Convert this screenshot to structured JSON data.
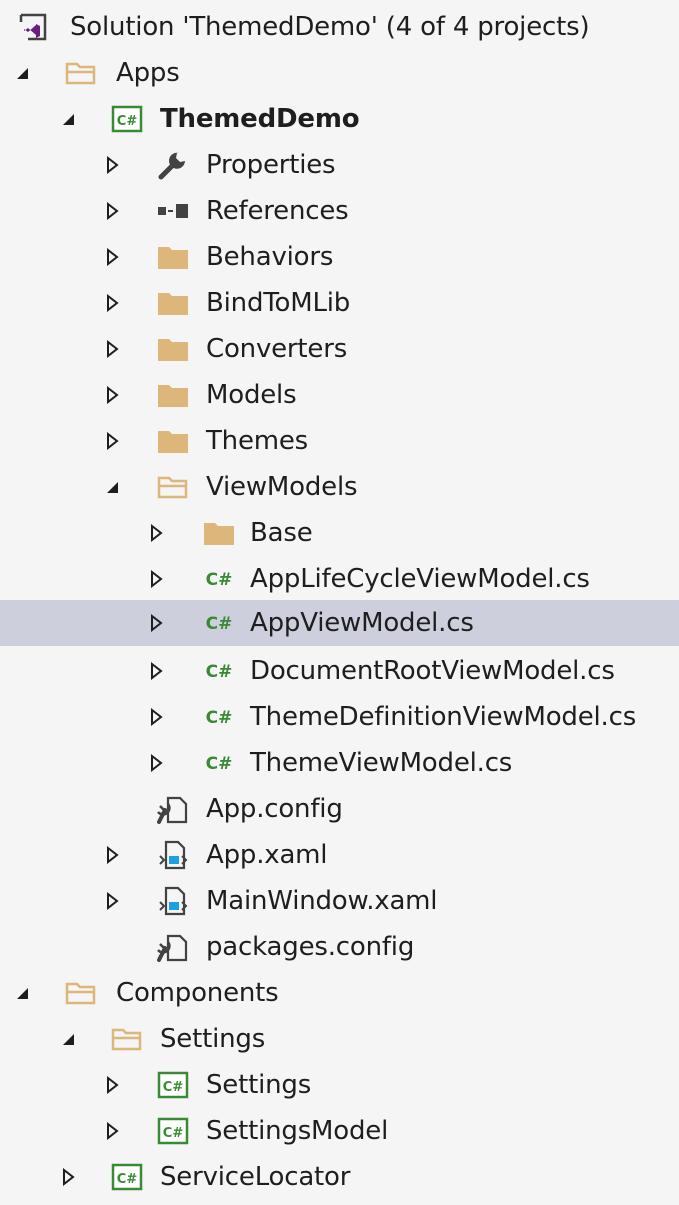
{
  "solution_explorer": {
    "solution_label": "Solution 'ThemedDemo' (4 of 4 projects)",
    "apps_folder": "Apps",
    "project_themeddemo": "ThemedDemo",
    "properties": "Properties",
    "references": "References",
    "behaviors": "Behaviors",
    "bindtomlib": "BindToMLib",
    "converters": "Converters",
    "models": "Models",
    "themes": "Themes",
    "viewmodels": "ViewModels",
    "vm_base": "Base",
    "vm_applifecycle": "AppLifeCycleViewModel.cs",
    "vm_appviewmodel": "AppViewModel.cs",
    "vm_documentroot": "DocumentRootViewModel.cs",
    "vm_themedefinition": "ThemeDefinitionViewModel.cs",
    "vm_themeviewmodel": "ThemeViewModel.cs",
    "app_config": "App.config",
    "app_xaml": "App.xaml",
    "mainwindow_xaml": "MainWindow.xaml",
    "packages_config": "packages.config",
    "components_folder": "Components",
    "settings_folder": "Settings",
    "settings_project": "Settings",
    "settingsmodel_project": "SettingsModel",
    "servicelocator_project": "ServiceLocator"
  },
  "selected_item": "AppViewModel.cs",
  "colors": {
    "background": "#f5f5f5",
    "selection": "#cdcfdc",
    "text": "#1e1e1e",
    "folder": "#dcb67a",
    "csharp": "#388a34",
    "vs_purple": "#68217a",
    "xaml_blue": "#1ba1e2"
  },
  "icons": {
    "solution": "visual-studio-solution-icon",
    "folder": "folder-icon",
    "folder_open": "folder-open-icon",
    "csproj": "csharp-project-icon",
    "csfile": "csharp-file-icon",
    "properties": "wrench-icon",
    "references": "references-icon",
    "config": "config-file-icon",
    "xaml": "xaml-file-icon"
  }
}
